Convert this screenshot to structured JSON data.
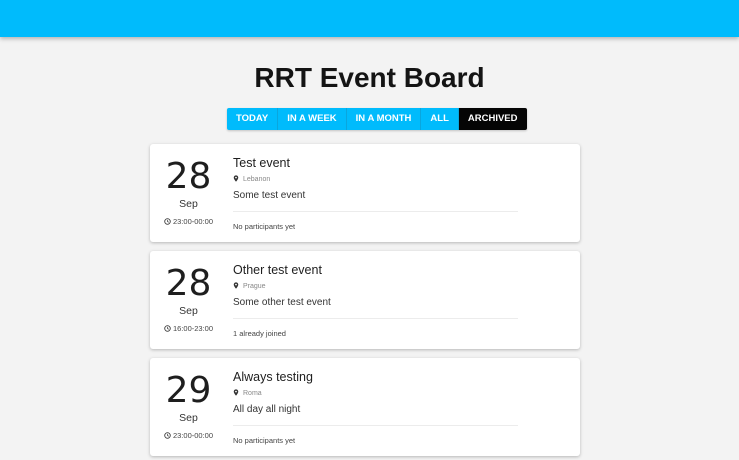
{
  "app": {
    "title": "RRT Event Board",
    "accent_color": "#00bbfc",
    "active_color": "#050505"
  },
  "filters": [
    {
      "label": "TODAY",
      "active": false
    },
    {
      "label": "IN A WEEK",
      "active": false
    },
    {
      "label": "IN A MONTH",
      "active": false
    },
    {
      "label": "ALL",
      "active": false
    },
    {
      "label": "ARCHIVED",
      "active": true
    }
  ],
  "events": [
    {
      "day": "28",
      "month": "Sep",
      "time": "23:00-00:00",
      "title": "Test event",
      "location": "Lebanon",
      "description": "Some test event",
      "participants": "No participants yet"
    },
    {
      "day": "28",
      "month": "Sep",
      "time": "16:00-23:00",
      "title": "Other test event",
      "location": "Prague",
      "description": "Some other test event",
      "participants": "1 already joined"
    },
    {
      "day": "29",
      "month": "Sep",
      "time": "23:00-00:00",
      "title": "Always testing",
      "location": "Roma",
      "description": "All day all night",
      "participants": "No participants yet"
    }
  ]
}
